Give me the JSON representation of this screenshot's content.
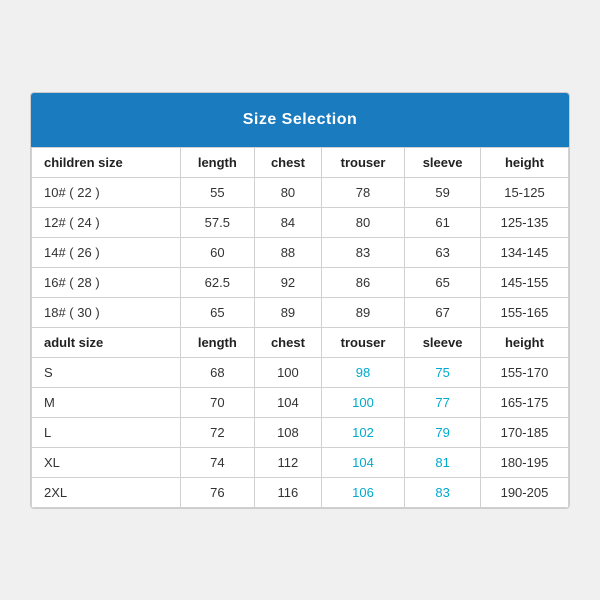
{
  "header": {
    "title": "Size Selection"
  },
  "columns": [
    "children size",
    "length",
    "chest",
    "trouser",
    "sleeve",
    "height"
  ],
  "adult_columns": [
    "adult size",
    "length",
    "chest",
    "trouser",
    "sleeve",
    "height"
  ],
  "children_rows": [
    {
      "size": "10# ( 22 )",
      "length": "55",
      "chest": "80",
      "trouser": "78",
      "sleeve": "59",
      "height": "15-125"
    },
    {
      "size": "12# ( 24 )",
      "length": "57.5",
      "chest": "84",
      "trouser": "80",
      "sleeve": "61",
      "height": "125-135"
    },
    {
      "size": "14# ( 26 )",
      "length": "60",
      "chest": "88",
      "trouser": "83",
      "sleeve": "63",
      "height": "134-145"
    },
    {
      "size": "16# ( 28 )",
      "length": "62.5",
      "chest": "92",
      "trouser": "86",
      "sleeve": "65",
      "height": "145-155"
    },
    {
      "size": "18# ( 30 )",
      "length": "65",
      "chest": "89",
      "trouser": "89",
      "sleeve": "67",
      "height": "155-165"
    }
  ],
  "adult_rows": [
    {
      "size": "S",
      "length": "68",
      "chest": "100",
      "trouser": "98",
      "sleeve": "75",
      "height": "155-170"
    },
    {
      "size": "M",
      "length": "70",
      "chest": "104",
      "trouser": "100",
      "sleeve": "77",
      "height": "165-175"
    },
    {
      "size": "L",
      "length": "72",
      "chest": "108",
      "trouser": "102",
      "sleeve": "79",
      "height": "170-185"
    },
    {
      "size": "XL",
      "length": "74",
      "chest": "112",
      "trouser": "104",
      "sleeve": "81",
      "height": "180-195"
    },
    {
      "size": "2XL",
      "length": "76",
      "chest": "116",
      "trouser": "106",
      "sleeve": "83",
      "height": "190-205"
    }
  ]
}
